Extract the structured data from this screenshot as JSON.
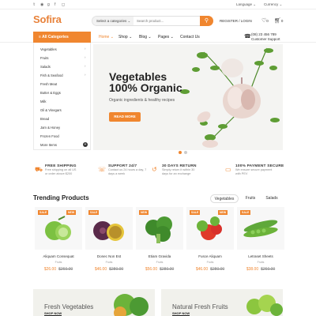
{
  "topbar": {
    "language": "Language",
    "currency": "Currency"
  },
  "header": {
    "logo": "Sofira",
    "search_category": "Select a categories",
    "search_placeholder": "Search product...",
    "register_login": "REGISTER / LOGIN",
    "wishlist_count": "0",
    "cart_count": "0"
  },
  "nav": {
    "all_categories": "All Categories",
    "links": [
      "Home",
      "Shop",
      "Blog",
      "Pages",
      "Contact Us"
    ],
    "phone": "(08) 23 456 789",
    "support": "Customer Support"
  },
  "sidebar": {
    "items": [
      "Vegetables",
      "Fruits",
      "Salads",
      "Fish & Seafood",
      "Fresh Meat",
      "Butter & Eggs",
      "Milk",
      "Oil & Vinegars",
      "Bread",
      "Jam & Honey",
      "Frozen Food",
      "More Items"
    ]
  },
  "hero": {
    "title_line1": "Vegetables",
    "title_line2": "100% Organic",
    "subtitle": "Organic ingredients & healthy recipes",
    "button": "READ MORE"
  },
  "features": [
    {
      "title": "FREE SHIPPING",
      "desc1": "Free shipping on all US",
      "desc2": "or order above $200"
    },
    {
      "title": "SUPPORT 24/7",
      "desc1": "Contact us 24 hours a day, 7",
      "desc2": "days a week"
    },
    {
      "title": "30 DAYS RETURN",
      "desc1": "Simply return it within 30",
      "desc2": "days for an exchange"
    },
    {
      "title": "100% PAYMENT SECURE",
      "desc1": "We ensure secure payment",
      "desc2": "with PEV"
    }
  ],
  "trending": {
    "title": "Trending Products",
    "tabs": [
      "Vegetables",
      "Fruits",
      "Salads"
    ]
  },
  "products": [
    {
      "name": "Aliquam Consequat",
      "brand": "Fruits",
      "price": "$26.00",
      "old": "$260.00",
      "badges": [
        "SALE",
        "NEW"
      ]
    },
    {
      "name": "Donec Non Est",
      "brand": "Fruits",
      "price": "$46.00",
      "old": "$280.00",
      "badges": [
        "SALE"
      ]
    },
    {
      "name": "Etiam Gravida",
      "brand": "Fruits",
      "price": "$56.00",
      "old": "$280.00",
      "badges": [
        "NEW"
      ]
    },
    {
      "name": "Fusce Aliquam",
      "brand": "Fruits",
      "price": "$46.00",
      "old": "$280.00",
      "badges": [
        "SALE",
        "NEW"
      ]
    },
    {
      "name": "Letraset Sheets",
      "brand": "Fruits",
      "price": "$38.00",
      "old": "$260.00",
      "badges": [
        "SALE"
      ]
    }
  ],
  "banners": [
    {
      "title": "Fresh Vegetables",
      "cta": "SHOP NOW"
    },
    {
      "title": "Natural Fresh Fruits",
      "cta": "SHOP NOW"
    }
  ],
  "colors": {
    "accent": "#f0862f",
    "sale": "#f0862f",
    "new": "#e05050"
  }
}
